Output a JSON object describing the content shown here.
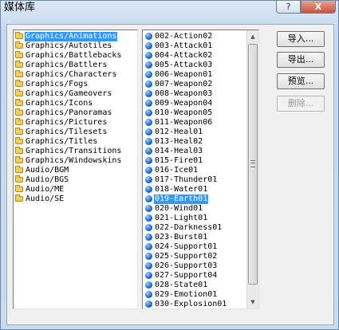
{
  "window": {
    "title": "媒体库",
    "help_label": "?",
    "close_label": "X"
  },
  "folders": [
    {
      "label": "Graphics/Animations",
      "selected": true
    },
    {
      "label": "Graphics/Autotiles"
    },
    {
      "label": "Graphics/Battlebacks"
    },
    {
      "label": "Graphics/Battlers"
    },
    {
      "label": "Graphics/Characters"
    },
    {
      "label": "Graphics/Fogs"
    },
    {
      "label": "Graphics/Gameovers"
    },
    {
      "label": "Graphics/Icons"
    },
    {
      "label": "Graphics/Panoramas"
    },
    {
      "label": "Graphics/Pictures"
    },
    {
      "label": "Graphics/Tilesets"
    },
    {
      "label": "Graphics/Titles"
    },
    {
      "label": "Graphics/Transitions"
    },
    {
      "label": "Graphics/Windowskins"
    },
    {
      "label": "Audio/BGM"
    },
    {
      "label": "Audio/BGS"
    },
    {
      "label": "Audio/ME"
    },
    {
      "label": "Audio/SE"
    }
  ],
  "files": [
    {
      "label": "002-Action02"
    },
    {
      "label": "003-Attack01"
    },
    {
      "label": "004-Attack02"
    },
    {
      "label": "005-Attack03"
    },
    {
      "label": "006-Weapon01"
    },
    {
      "label": "007-Weapon02"
    },
    {
      "label": "008-Weapon03"
    },
    {
      "label": "009-Weapon04"
    },
    {
      "label": "010-Weapon05"
    },
    {
      "label": "011-Weapon06"
    },
    {
      "label": "012-Heal01"
    },
    {
      "label": "013-Heal02"
    },
    {
      "label": "014-Heal03"
    },
    {
      "label": "015-Fire01"
    },
    {
      "label": "016-Ice01"
    },
    {
      "label": "017-Thunder01"
    },
    {
      "label": "018-Water01"
    },
    {
      "label": "019-Earth01",
      "selected": true
    },
    {
      "label": "020-Wind01"
    },
    {
      "label": "021-Light01"
    },
    {
      "label": "022-Darkness01"
    },
    {
      "label": "023-Burst01"
    },
    {
      "label": "024-Support01"
    },
    {
      "label": "025-Support02"
    },
    {
      "label": "026-Support03"
    },
    {
      "label": "027-Support04"
    },
    {
      "label": "028-State01"
    },
    {
      "label": "029-Emotion01"
    },
    {
      "label": "030-Explosion01"
    }
  ],
  "buttons": {
    "import_label": "导入...",
    "export_label": "导出...",
    "preview_label": "预览...",
    "delete_label": "删除..."
  },
  "icons": {
    "folder": "folder-icon",
    "file": "blue-ball-icon"
  },
  "colors": {
    "selection": "#3399ff",
    "window_frame": "#c8d9ec"
  }
}
